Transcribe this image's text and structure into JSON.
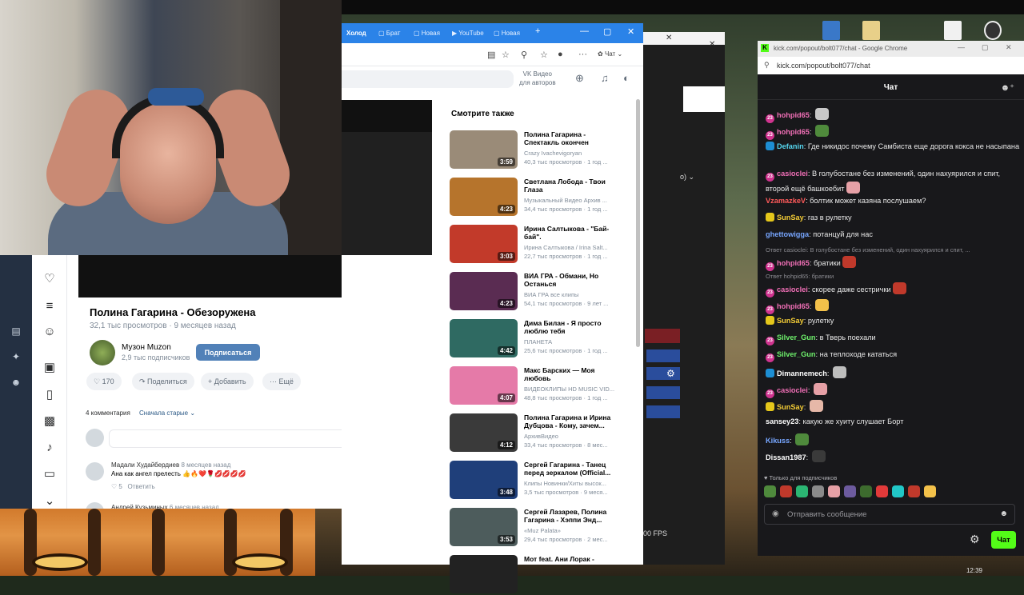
{
  "browser": {
    "tabs": [
      "Холод",
      "Брат",
      "Новая",
      "YouTube",
      "Новая"
    ],
    "chat_toggle_label": "Чат",
    "vk_brand_line1": "VK Видео",
    "vk_brand_line2": "для авторов"
  },
  "video": {
    "title": "Полина Гагарина - Обезоружена",
    "views": "32,1 тыс просмотров",
    "age": "9 месяцев назад",
    "channel": "Музон Muzon",
    "subscribers": "2,9 тыс подписчиков",
    "subscribe_label": "Подписаться",
    "likes": "170",
    "share_label": "Поделиться",
    "add_label": "Добавить",
    "more_label": "Ещё",
    "comments_count": "4 комментария",
    "sort_label": "Сначала старые"
  },
  "comments": [
    {
      "author": "Мадали Худайбердиев",
      "time": "8 месяцев назад",
      "text": "Ана как ангел прелесть 👍🔥❤️🌹💋💋💋💋",
      "likes": "5",
      "reply": "Ответить"
    },
    {
      "author": "Андрей Кузьминых",
      "time": "6 месяцев назад",
      "text": "",
      "likes": "",
      "reply": ""
    }
  ],
  "related": {
    "heading": "Смотрите также",
    "items": [
      {
        "title": "Полина Гагарина - Спектакль окончен",
        "channel": "Crazy Ivachevigoryan",
        "stats": "40,3 тыс просмотров · 1 год ...",
        "duration": "3:59",
        "color": "#9a8b78"
      },
      {
        "title": "Светлана Лобода - Твои Глаза",
        "channel": "Музыкальный Видео Архив ...",
        "stats": "34,4 тыс просмотров · 1 год ...",
        "duration": "4:23",
        "color": "#b6742c"
      },
      {
        "title": "Ирина Салтыкова - \"Бай-бай\".",
        "channel": "Ирина Салтыкова / Irina Salt...",
        "stats": "22,7 тыс просмотров · 1 год ...",
        "duration": "3:03",
        "color": "#c23a2a"
      },
      {
        "title": "ВИА ГРА - Обмани, Но Останься",
        "channel": "ВИА ГРА все клипы",
        "stats": "54,1 тыс просмотров · 9 лет ...",
        "duration": "4:23",
        "color": "#5a2c52"
      },
      {
        "title": "Дима Билан - Я просто люблю тебя",
        "channel": "ПЛАНЕТА",
        "stats": "25,6 тыс просмотров · 1 год ...",
        "duration": "4:42",
        "color": "#2f6a62"
      },
      {
        "title": "Макс Барских — Моя любовь",
        "channel": "ВИДЕОКЛИПЫ HD MUSIC VID...",
        "stats": "48,8 тыс просмотров · 1 год ...",
        "duration": "4:07",
        "color": "#e57aa8"
      },
      {
        "title": "Полина Гагарина и Ирина Дубцова - Кому, зачем...",
        "channel": "АрхивВидео",
        "stats": "33,4 тыс просмотров · 8 мес...",
        "duration": "4:12",
        "color": "#3a3a3a"
      },
      {
        "title": "Сергей Гагарина - Танец перед зеркалом (Official...",
        "channel": "Клипы Новинки/Хиты высок...",
        "stats": "3,5 тыс просмотров · 9 меся...",
        "duration": "3:48",
        "color": "#1f3f7a"
      },
      {
        "title": "Сергей Лазарев, Полина Гагарина - Хэппи Энд...",
        "channel": "«Muz Palata»",
        "stats": "29,4 тыс просмотров · 2 мес...",
        "duration": "3:53",
        "color": "#4d5c5c"
      },
      {
        "title": "Мот feat. Ани Лорак -",
        "channel": "",
        "stats": "",
        "duration": "",
        "color": "#222222"
      }
    ]
  },
  "obs": {
    "dropdown_text": "о) ⌄",
    "fps": "00 FPS"
  },
  "kick": {
    "window_title": "kick.com/popout/bolt077/chat - Google Chrome",
    "url": "kick.com/popout/bolt077/chat",
    "header": "Чат",
    "subs_only": "Только для подписчиков",
    "input_placeholder": "Отправить сообщение",
    "send_label": "Чат",
    "messages": [
      {
        "user": "hohpid65",
        "text": "",
        "badge": "sub",
        "color": "u-pink",
        "emote": "#c8c8c8"
      },
      {
        "user": "hohpid65",
        "text": "",
        "badge": "sub",
        "color": "u-pink",
        "emote": "#4f8a3c"
      },
      {
        "user": "Defanin",
        "text": "Где никидос почему Самбиста еще дорога кокса не насыпана",
        "badge": "og",
        "color": "u-cyan",
        "emote": ""
      },
      {
        "user": "casioclei",
        "text": "В голубостане без изменений, один нахуярился и спит, второй ещё башкоебит",
        "badge": "sub",
        "color": "u-pink",
        "emote": "#e6a0a6"
      },
      {
        "user": "VzamazkeV",
        "text": "болтик может казяна послушаем?",
        "badge": "",
        "color": "u-red",
        "emote": ""
      },
      {
        "user": "SunSay",
        "text": "газ в рулетку",
        "badge": "vip",
        "color": "u-yellow",
        "emote": ""
      },
      {
        "user": "ghettowigga",
        "text": "потанцуй для нас",
        "badge": "",
        "color": "u-blue",
        "emote": ""
      },
      {
        "user": "hohpid65",
        "text": "братики",
        "badge": "sub",
        "color": "u-pink",
        "emote": "#c0392b",
        "reply": "Ответ casioclei: В голубостане без изменений, один нахуярился и спит, ..."
      },
      {
        "user": "casioclei",
        "text": "скорее даже сестрички",
        "badge": "sub",
        "color": "u-pink",
        "emote": "#c0392b",
        "reply": "Ответ hohpid65: братики"
      },
      {
        "user": "hohpid65",
        "text": "",
        "badge": "sub",
        "color": "u-pink",
        "emote": "#f3c14a"
      },
      {
        "user": "SunSay",
        "text": "рулетку",
        "badge": "vip",
        "color": "u-yellow",
        "emote": ""
      },
      {
        "user": "Silver_Gun",
        "text": "в Тверь поехали",
        "badge": "sub",
        "color": "u-green",
        "emote": ""
      },
      {
        "user": "Silver_Gun",
        "text": "на теплоходе кататься",
        "badge": "sub",
        "color": "u-green",
        "emote": ""
      },
      {
        "user": "Dimannemech",
        "text": "",
        "badge": "og",
        "color": "u-white",
        "emote": "#bdbdbd"
      },
      {
        "user": "casioclei",
        "text": "",
        "badge": "sub",
        "color": "u-pink",
        "emote": "#e6a0a6"
      },
      {
        "user": "SunSay",
        "text": "",
        "badge": "vip",
        "color": "u-yellow",
        "emote": "#e6b8a8"
      },
      {
        "user": "sansey23",
        "text": "какую же хуиту слушает Борт",
        "badge": "",
        "color": "u-white",
        "emote": ""
      },
      {
        "user": "Kikuss",
        "text": "",
        "badge": "",
        "color": "u-blue",
        "emote": "#4f8a3c"
      },
      {
        "user": "Dissan1987",
        "text": "",
        "badge": "",
        "color": "u-white",
        "emote": "#3a3a3a"
      }
    ],
    "emote_colors": [
      "#4f8a3c",
      "#c0392b",
      "#2bb673",
      "#8a8a8a",
      "#e6a0a6",
      "#6c5a9e",
      "#3d6b2e",
      "#e23a3a",
      "#21c7c7",
      "#c0392b",
      "#f3c14a"
    ]
  },
  "clock": "12:39"
}
